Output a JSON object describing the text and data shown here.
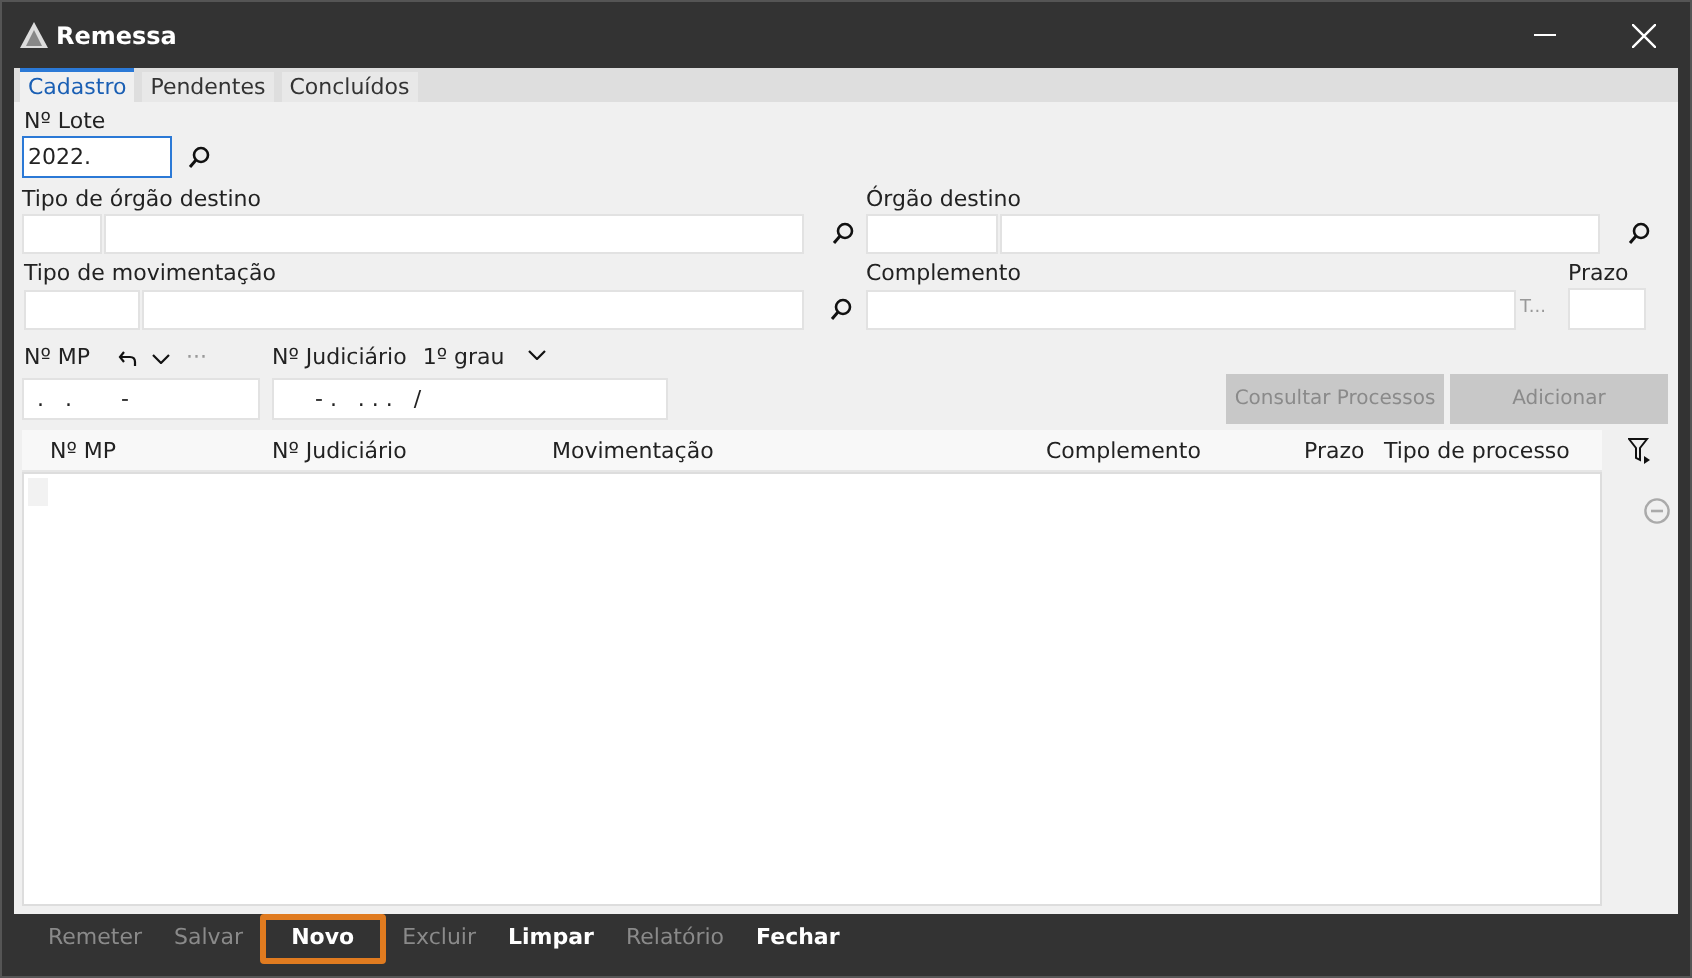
{
  "window": {
    "title": "Remessa"
  },
  "tabs": [
    {
      "label": "Cadastro",
      "selected": true
    },
    {
      "label": "Pendentes",
      "selected": false
    },
    {
      "label": "Concluídos",
      "selected": false
    }
  ],
  "lote": {
    "label": "Nº Lote",
    "value": "2022."
  },
  "tipo_orgao": {
    "label": "Tipo de órgão destino"
  },
  "orgao": {
    "label": "Órgão destino"
  },
  "tipo_mov": {
    "label": "Tipo de movimentação"
  },
  "complemento": {
    "label": "Complemento",
    "hint": "T..."
  },
  "prazo": {
    "label": "Prazo"
  },
  "mp": {
    "label": "Nº MP",
    "value": " .   .       -",
    "more": "···"
  },
  "judiciario": {
    "label": "Nº Judiciário",
    "grau": "1º grau",
    "value": "     - .   . . .   /"
  },
  "actions": [
    {
      "label": "Consultar Processos",
      "disabled": true
    },
    {
      "label": "Adicionar",
      "disabled": true
    }
  ],
  "table": {
    "columns": [
      "Nº MP",
      "Nº Judiciário",
      "Movimentação",
      "Complemento",
      "Prazo",
      "Tipo de processo"
    ]
  },
  "toolbar": [
    {
      "label": "Remeter",
      "disabled": true,
      "focused": false
    },
    {
      "label": "Salvar",
      "disabled": true,
      "focused": false
    },
    {
      "label": "Novo",
      "disabled": false,
      "focused": true
    },
    {
      "label": "Excluir",
      "disabled": true,
      "focused": false
    },
    {
      "label": "Limpar",
      "disabled": false,
      "focused": false
    },
    {
      "label": "Relatório",
      "disabled": true,
      "focused": false
    },
    {
      "label": "Fechar",
      "disabled": false,
      "focused": false
    }
  ]
}
